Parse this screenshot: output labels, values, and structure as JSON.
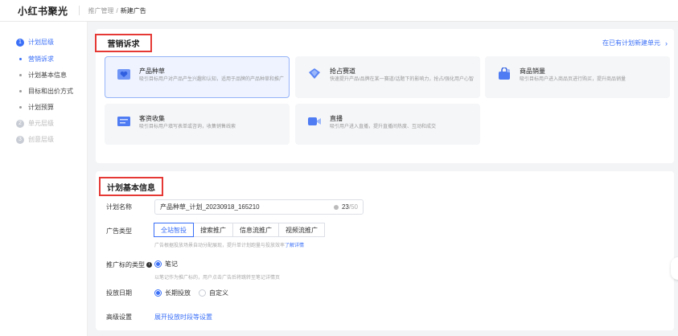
{
  "app": {
    "title": "小红书聚光"
  },
  "breadcrumb": {
    "parent": "推广管理",
    "separator": "/",
    "current": "新建广告"
  },
  "steps": [
    {
      "num": "1",
      "label": "计划层级"
    },
    {
      "num": "2",
      "label": "单元层级"
    },
    {
      "num": "3",
      "label": "创意层级"
    }
  ],
  "substeps": [
    "营销诉求",
    "计划基本信息",
    "目标和出价方式",
    "计划预算"
  ],
  "marketing": {
    "title": "营销诉求",
    "new_link": "在已有计划新建单元",
    "goals": [
      {
        "name": "产品种草",
        "desc": "吸引目标用户对产品产生兴趣和认知，适用于品牌的产品种草和推广",
        "icon": "heart-box-icon"
      },
      {
        "name": "抢占赛道",
        "desc": "快速提升产品/品牌在某一赛道/话题下的影响力，抢占/强化用户心智",
        "icon": "diamond-icon"
      },
      {
        "name": "商品销量",
        "desc": "吸引目标用户进入商品页进行购买，提升商品销量",
        "icon": "shopping-bag-icon"
      },
      {
        "name": "客资收集",
        "desc": "吸引目标用户填写表单或咨询，收集销售线索",
        "icon": "form-icon"
      },
      {
        "name": "直播",
        "desc": "吸引用户进入直播，提升直播间热度、互动和成交",
        "icon": "live-camera-icon"
      }
    ]
  },
  "basic": {
    "title": "计划基本信息",
    "plan_name_label": "计划名称",
    "plan_name_value": "产品种草_计划_20230918_165210",
    "plan_name_count": "23",
    "plan_name_max": "/50",
    "ad_type_label": "广告类型",
    "ad_types": [
      "全站智投",
      "搜索推广",
      "信息流推广",
      "视频流推广"
    ],
    "ad_type_hint": "广告根据投放场景自动分配展现，提升单计划跑量与投放效率",
    "ad_type_link": "了解详情",
    "promo_label": "推广标的类型",
    "promo_option": "笔记",
    "promo_hint": "以笔记作为推广标的，用户点击广告后将跳转至笔记详情页",
    "date_label": "投放日期",
    "date_options": [
      "长期投放",
      "自定义"
    ],
    "advanced_label": "高级设置",
    "advanced_link": "展开投放时段等设置"
  },
  "colors": {
    "accent": "#3a6ff7",
    "highlight_box": "#e53935"
  }
}
